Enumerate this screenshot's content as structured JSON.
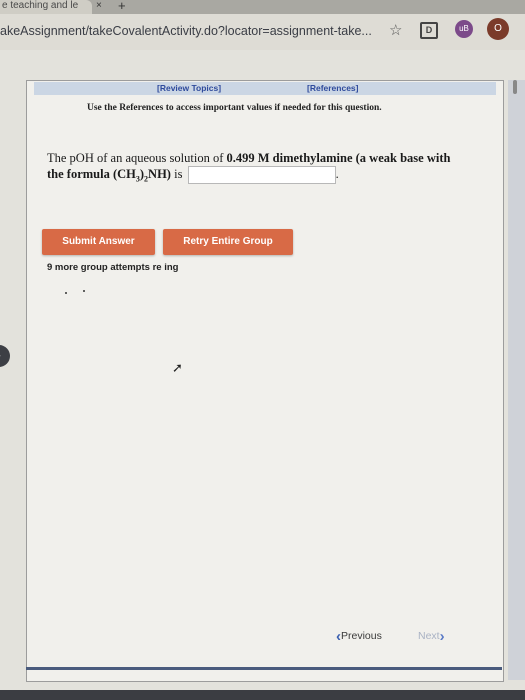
{
  "browser": {
    "tab_title": "e teaching and le",
    "tab_close": "×",
    "tab_new": "+",
    "url": "akeAssignment/takeCovalentActivity.do?locator=assignment-take...",
    "star_icon": "☆",
    "ext1_label": "D",
    "ext2_label": "uB",
    "avatar_label": "O"
  },
  "references_bar": {
    "review_topics": "[Review Topics]",
    "references": "[References]"
  },
  "instruction": "Use the References to access important values if needed for this question.",
  "question": {
    "part1": "The pOH of an aqueous solution of ",
    "concentration": "0.499 M dimethylamine (a weak base with the formula (CH",
    "sub3": "3",
    "close_paren": ")",
    "sub2": "2",
    "nh": "NH)",
    "part2": " is",
    "answer_value": "",
    "period": "."
  },
  "buttons": {
    "submit": "Submit Answer",
    "retry": "Retry Entire Group"
  },
  "attempts_text": "9 more group attempts re   ing",
  "nav": {
    "previous": "Previous",
    "next": "Next"
  },
  "colors": {
    "button_bg": "#d86a46",
    "link": "#2e4a9c",
    "nav_chevron": "#3a5fb0"
  }
}
